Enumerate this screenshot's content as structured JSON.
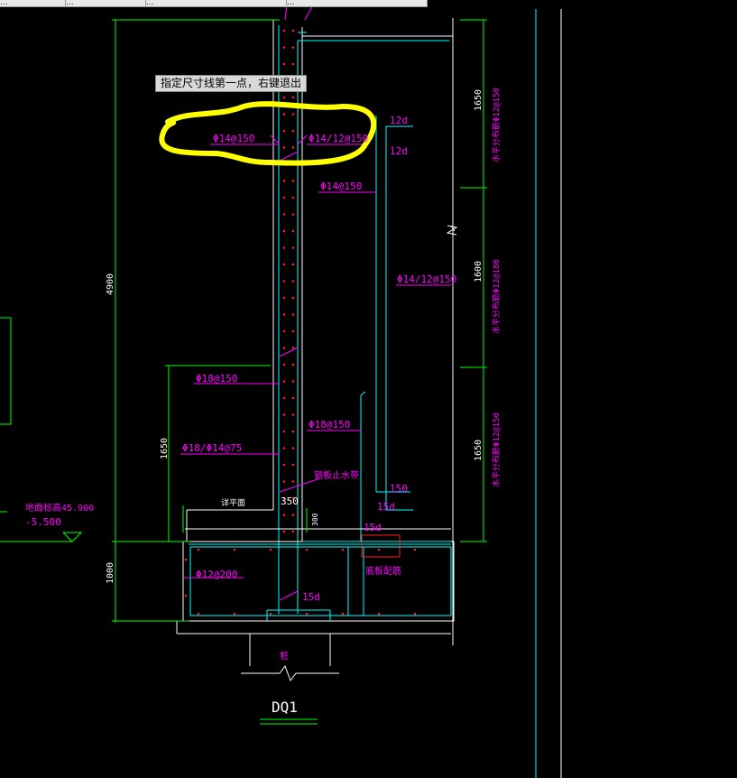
{
  "tabs": [
    "...",
    "...",
    "...",
    "..."
  ],
  "tooltip": "指定尺寸线第一点，右键退出",
  "labels": {
    "rebar_top_left": "Φ14@150",
    "rebar_top_right": "Φ14/12@150",
    "anchor_12d_a": "12d",
    "anchor_12d_b": "12d",
    "rebar_outer_upper": "Φ14@150",
    "rebar_outer_mid": "Φ14/12@150",
    "rebar_inner_18": "Φ18@150",
    "rebar_outer_18": "Φ18@150",
    "rebar_combo": "Φ18/Φ14@75",
    "waterstop": "钢板止水带",
    "dim_350": "350",
    "dim_300": "300",
    "slab_label": "详平面",
    "anchor_150": "150",
    "anchor_15d_a": "15d",
    "anchor_15d_b": "15d",
    "anchor_15d_c": "15d",
    "rebar_base": "Φ12@200",
    "base_note": "底板配筋",
    "pile": "桩",
    "elev_top": "地面标高45.900",
    "elev_bottom": "-5.500",
    "dim_4900": "4900",
    "dim_1650_left": "1650",
    "dim_1000": "1000",
    "dim_1650_r1": "1650",
    "dim_1600_r": "1600",
    "dim_1650_r2": "1650",
    "dist_top": "水平分布筋Φ12@150",
    "dist_mid": "水平分布筋Φ12@180",
    "dist_bot": "水平分布筋Φ12@150",
    "section_title": "DQ1"
  },
  "colors": {
    "background": "#000000",
    "dimension": "#00ff00",
    "rebar_text": "#ff00ff",
    "outline": "#00ffff",
    "concrete": "#ffffff",
    "highlight": "#ffff00",
    "rebar_dot": "#ff2020"
  }
}
